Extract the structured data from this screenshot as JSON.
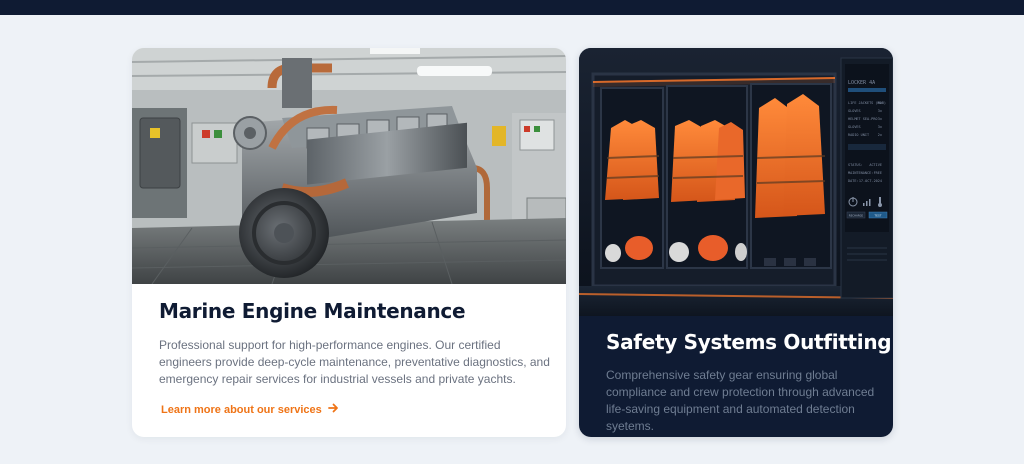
{
  "colors": {
    "page_bg": "#eef2f7",
    "navy": "#0f1b33",
    "accent_orange": "#ef7417",
    "muted_text": "#6b7280"
  },
  "cards": [
    {
      "title": "Marine Engine Maintenance",
      "description": "Professional support for high-performance engines. Our certified engineers provide deep-cycle maintenance, preventative diagnostics, and emergency repair services for industrial vessels and private yachts.",
      "link_label": "Learn more about our services",
      "link_icon": "arrow-right-icon",
      "image": "engine-room-photo"
    },
    {
      "title": "Safety Systems Outfitting",
      "description": "Comprehensive safety gear ensuring global compliance and crew protection through advanced life-saving equipment and automated detection syetems.",
      "image": "life-jacket-locker-photo",
      "panel": {
        "title": "LOCKER 4A",
        "rows": [
          [
            "LIFE JACKETS (MOB)",
            "8x"
          ],
          [
            "GLOVES",
            "3x"
          ],
          [
            "HELMET SEA-PRO",
            "3x"
          ],
          [
            "GLOVES",
            "3x"
          ],
          [
            "RADIO UNIT",
            "2x"
          ]
        ],
        "status_rows": [
          [
            "STATUS:",
            "ACTIVE"
          ],
          [
            "MAINTENANCE:",
            "FREE"
          ],
          [
            "DATE:",
            "17-OCT-2024"
          ]
        ],
        "buttons": [
          "RECHARGE",
          "TEST"
        ]
      }
    }
  ]
}
